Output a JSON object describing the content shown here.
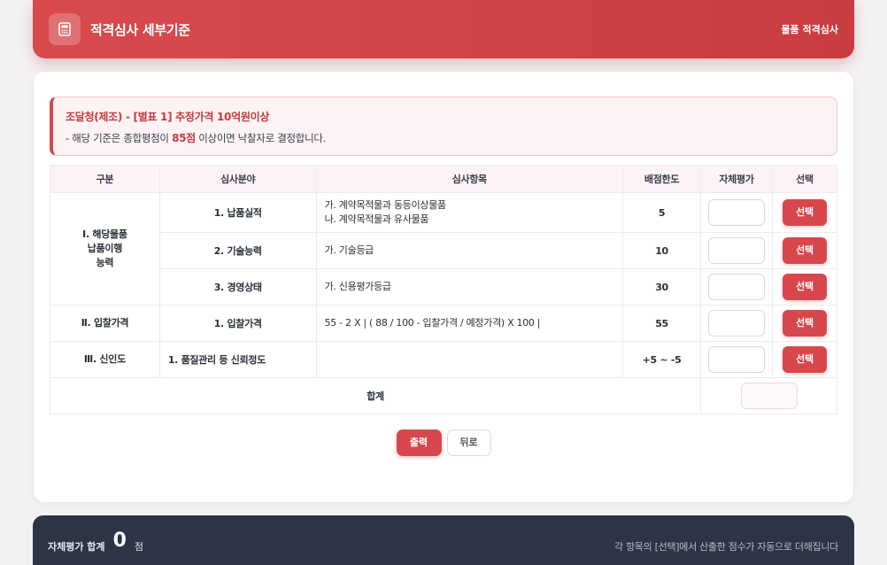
{
  "header": {
    "icon": "calculator-icon",
    "title": "적격심사 세부기준",
    "right_label": "물품 적격심사"
  },
  "notice": {
    "title": "조달청(제조) - [별표 1] 추정가격 10억원이상",
    "desc_prefix": "- 해당 기준은 종합평점이 ",
    "desc_score": "85점",
    "desc_suffix": " 이상이면 낙찰자로 결정합니다."
  },
  "table": {
    "headers": [
      "구분",
      "심사분야",
      "심사항목",
      "배점한도",
      "자체평가",
      "선택"
    ],
    "groups": [
      {
        "category_lines": [
          "Ⅰ. 해당물품",
          "납품이행",
          "능력"
        ],
        "rows": [
          {
            "field": "1. 납품실적",
            "items": [
              "가. 계약목적물과 동등이상물품",
              "나. 계약목적물과 유사물품"
            ],
            "score": "5"
          },
          {
            "field": "2. 기술능력",
            "items": [
              "가. 기술등급"
            ],
            "score": "10"
          },
          {
            "field": "3. 경영상태",
            "items": [
              "가. 신용평가등급"
            ],
            "score": "30"
          }
        ]
      },
      {
        "category_lines": [
          "Ⅱ. 입찰가격"
        ],
        "rows": [
          {
            "field": "1. 입찰가격",
            "items": [
              "55 - 2 X | ( 88 / 100 - 입찰가격 / 예정가격) X 100 |"
            ],
            "score": "55"
          }
        ]
      },
      {
        "category_lines": [
          "Ⅲ. 신인도"
        ],
        "rows": [
          {
            "field": "1. 품질관리 등 신뢰정도",
            "items": [
              ""
            ],
            "score": "+5 ~ -5"
          }
        ]
      }
    ],
    "select_label": "선택",
    "total_label": "합계"
  },
  "buttons": {
    "print_label": "출력",
    "back_label": "뒤로"
  },
  "footer": {
    "label": "자체평가 합계",
    "total": "0",
    "unit": "점",
    "hint": "각 항목의 [선택]에서 산출한 점수가 자동으로 더해집니다"
  },
  "colors": {
    "accent": "#d8474b",
    "footer_bg": "#2c3445"
  }
}
